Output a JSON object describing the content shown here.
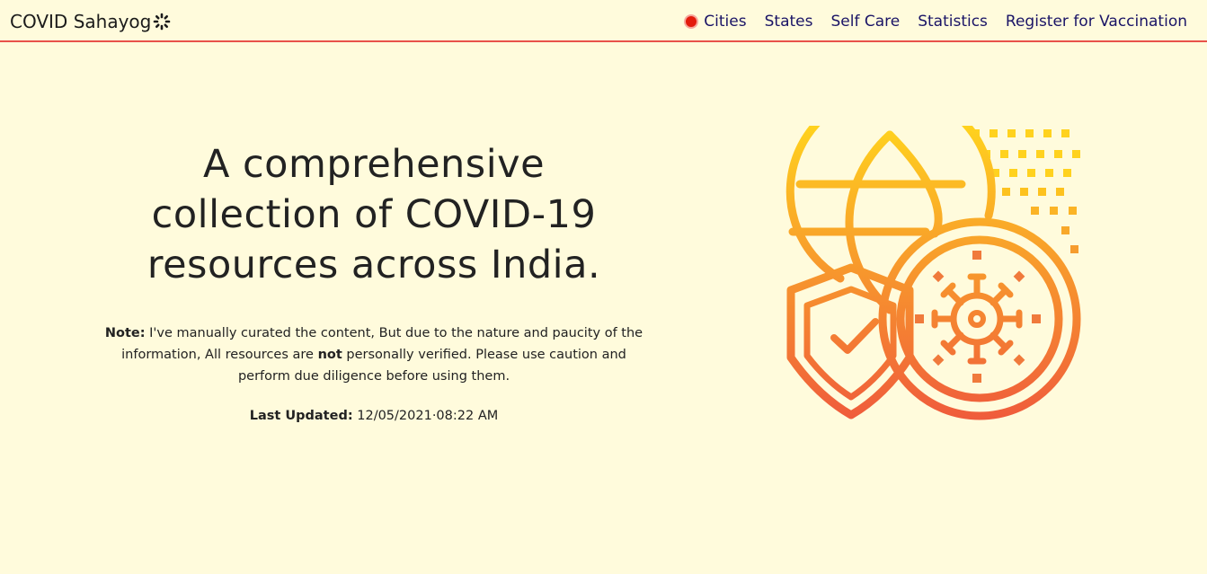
{
  "nav": {
    "brand": "COVID Sahayog",
    "links": [
      "Cities",
      "States",
      "Self Care",
      "Statistics",
      "Register for Vaccination"
    ]
  },
  "hero": {
    "headline_lines": [
      "A comprehensive",
      "collection of COVID-19",
      "resources across India."
    ],
    "note_label": "Note:",
    "note_text_1": " I've manually curated the content, But due to the nature and paucity of the information, All resources are ",
    "note_bold": "not",
    "note_text_2": " personally verified. Please use caution and perform due diligence before using them.",
    "updated_label": "Last Updated:",
    "updated_value": " 12/05/2021·08:22 AM"
  },
  "colors": {
    "background": "#fffbdc",
    "nav_border": "#e8524a",
    "nav_link": "#1a1466",
    "live_dot": "#e31b0c",
    "gradient_top": "#ffd21e",
    "gradient_bottom": "#ef5a3c"
  },
  "icons": [
    "spark-icon",
    "live-dot-icon",
    "globe-shield-virus-illustration"
  ]
}
